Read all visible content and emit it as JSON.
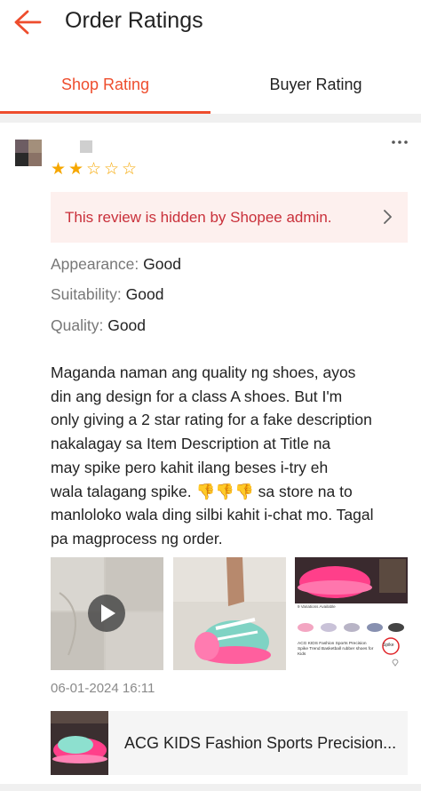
{
  "header": {
    "title": "Order Ratings",
    "back_icon": "arrow-left-icon"
  },
  "tabs": [
    {
      "label": "Shop Rating",
      "active": true
    },
    {
      "label": "Buyer Rating",
      "active": false
    }
  ],
  "colors": {
    "accent": "#ee4d2d",
    "star": "#f6a700",
    "hidden_text": "#c9303a",
    "hidden_bg": "#fdf0ee"
  },
  "review": {
    "rating": 2,
    "max_rating": 5,
    "hidden_notice": "This review is hidden by Shopee admin.",
    "attributes": [
      {
        "label": "Appearance:",
        "value": "Good"
      },
      {
        "label": "Suitability:",
        "value": "Good"
      },
      {
        "label": "Quality:",
        "value": "Good"
      }
    ],
    "text_lines": [
      "Maganda naman ang quality ng shoes, ayos",
      "din ang design for a class A shoes. But I'm",
      "only giving a 2 star rating for a fake description",
      "nakalagay sa Item Description at Title na",
      "may spike pero kahit ilang beses i-try eh",
      "wala talagang spike. 👎👎👎 sa store na to",
      "manloloko wala ding silbi kahit i-chat mo. Tagal",
      "pa magprocess ng order."
    ],
    "media": [
      {
        "type": "video",
        "icon": "play-icon"
      },
      {
        "type": "photo"
      },
      {
        "type": "screenshot",
        "variations_text": "9 Variations Available",
        "listing_title": "ACG KIDS Fashion Sports Precision Spike Trend Basketball rubber shoes for Kids",
        "circled_word": "Spike"
      }
    ],
    "timestamp": "06-01-2024 16:11"
  },
  "product": {
    "name": "ACG KIDS Fashion Sports Precision..."
  }
}
